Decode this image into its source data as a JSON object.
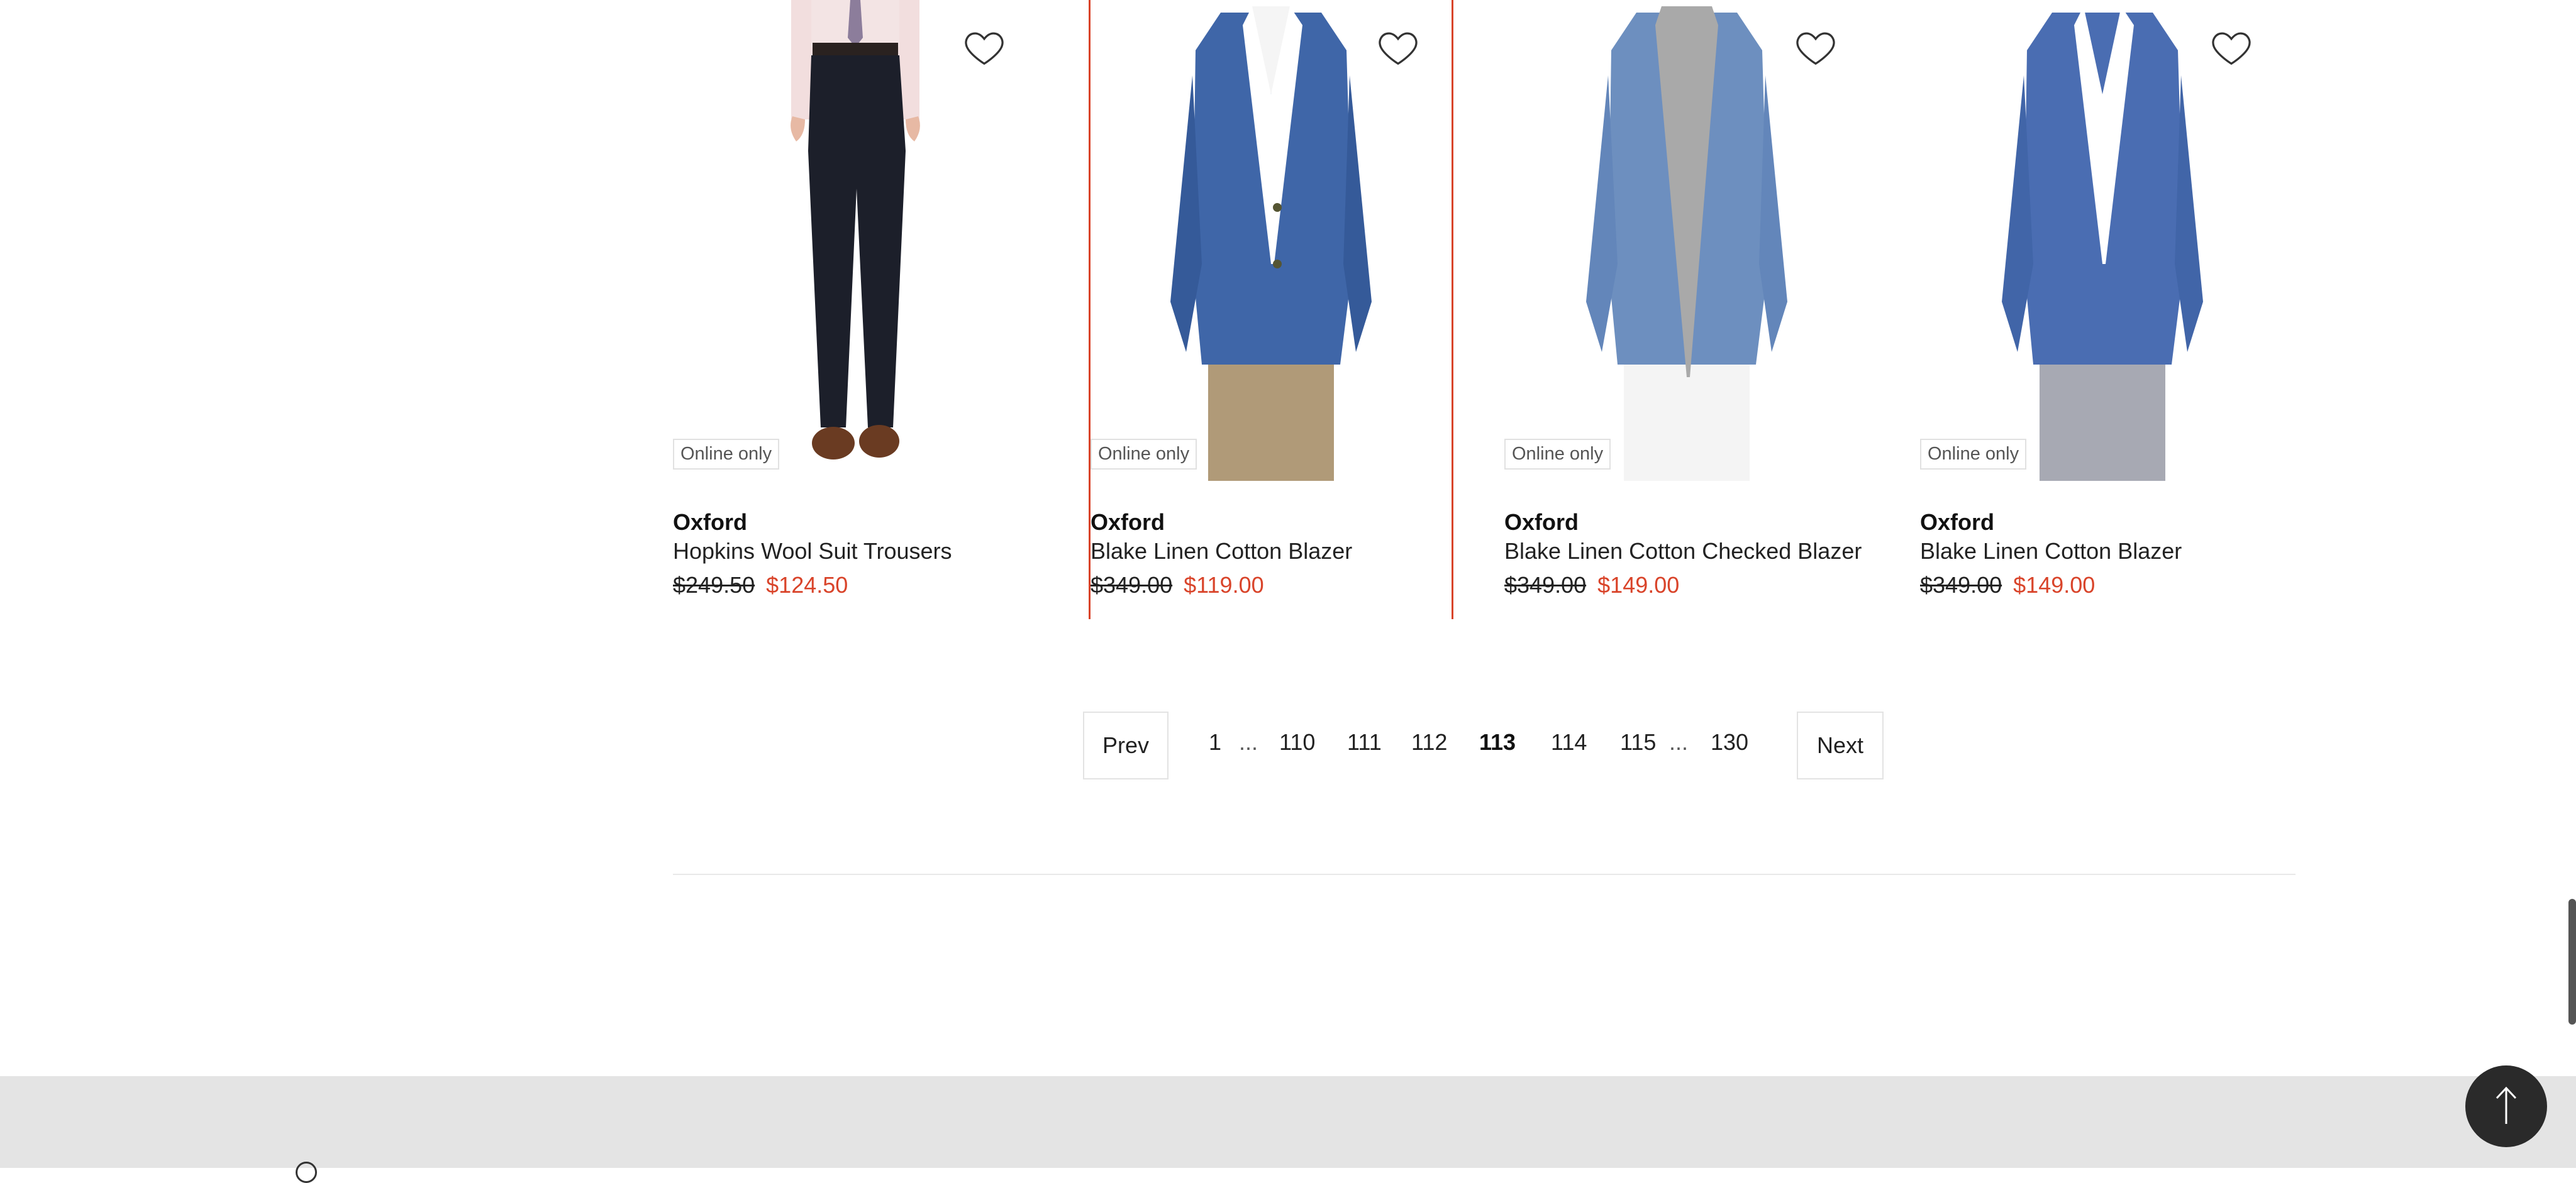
{
  "products": [
    {
      "badge": "Online only",
      "brand": "Oxford",
      "name": "Hopkins Wool Suit Trousers",
      "was": "$249.50",
      "now": "$124.50"
    },
    {
      "badge": "Online only",
      "brand": "Oxford",
      "name": "Blake Linen Cotton Blazer",
      "was": "$349.00",
      "now": "$119.00"
    },
    {
      "badge": "Online only",
      "brand": "Oxford",
      "name": "Blake Linen Cotton Checked Blazer",
      "was": "$349.00",
      "now": "$149.00"
    },
    {
      "badge": "Online only",
      "brand": "Oxford",
      "name": "Blake Linen Cotton Blazer",
      "was": "$349.00",
      "now": "$149.00"
    }
  ],
  "pagination": {
    "prev": "Prev",
    "next": "Next",
    "pages": [
      "1",
      "110",
      "111",
      "112",
      "113",
      "114",
      "115",
      "130"
    ],
    "ellipsis": "...",
    "current": "113"
  },
  "colors": {
    "sale": "#d9442a",
    "selected_outline": "#d9442a"
  }
}
